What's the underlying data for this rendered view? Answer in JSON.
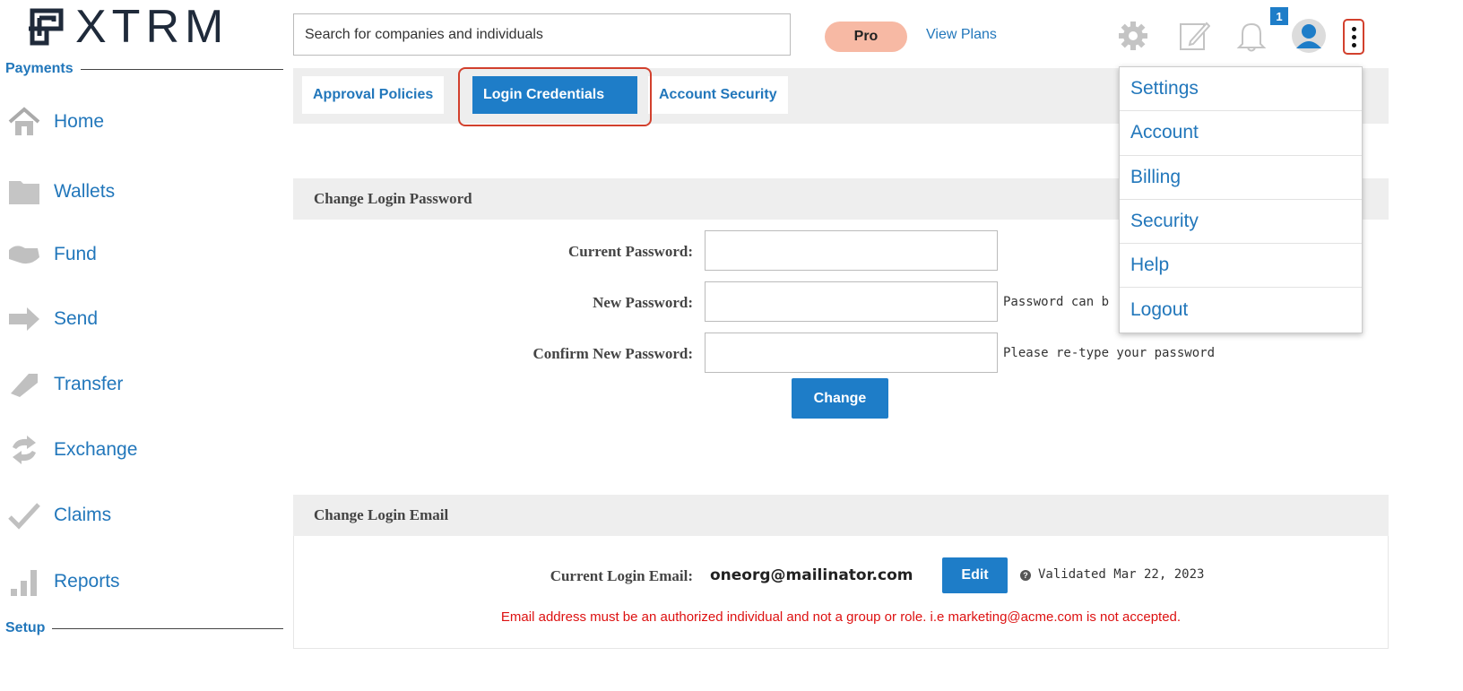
{
  "logo": {
    "text": "XTRM"
  },
  "sidebar": {
    "payments_label": "Payments",
    "setup_label": "Setup",
    "items": [
      {
        "label": "Home",
        "icon": "home-icon"
      },
      {
        "label": "Wallets",
        "icon": "folder-icon"
      },
      {
        "label": "Fund",
        "icon": "fund-icon"
      },
      {
        "label": "Send",
        "icon": "arrow-right-icon"
      },
      {
        "label": "Transfer",
        "icon": "transfer-icon"
      },
      {
        "label": "Exchange",
        "icon": "exchange-icon"
      },
      {
        "label": "Claims",
        "icon": "checkmark-icon"
      },
      {
        "label": "Reports",
        "icon": "bar-chart-icon"
      }
    ]
  },
  "header": {
    "search_placeholder": "Search for companies and individuals",
    "pro_label": "Pro",
    "view_plans_label": "View Plans",
    "notification_count": "1",
    "icons": [
      "gear-icon",
      "edit-icon",
      "bell-icon",
      "user-avatar-icon",
      "more-vertical-icon"
    ]
  },
  "tabs": [
    {
      "label": "Approval Policies",
      "active": false
    },
    {
      "label": "Login Credentials",
      "active": true
    },
    {
      "label": "Account Security",
      "active": false
    }
  ],
  "change_password": {
    "title": "Change Login Password",
    "current_label": "Current Password:",
    "new_label": "New Password:",
    "new_hint": "Password can b",
    "confirm_label": "Confirm New Password:",
    "confirm_hint": "Please re-type your password",
    "button_label": "Change"
  },
  "change_email": {
    "title": "Change Login Email",
    "current_label": "Current Login Email:",
    "email_value": "oneorg@mailinator.com",
    "edit_label": "Edit",
    "validated_text": "Validated Mar 22, 2023",
    "warning": "Email address must be an authorized individual and not a group or role. i.e marketing@acme.com is not accepted."
  },
  "dropdown_menu": {
    "items": [
      "Settings",
      "Account",
      "Billing",
      "Security",
      "Help",
      "Logout"
    ]
  },
  "colors": {
    "accent": "#1e7dc8",
    "link": "#2277bb",
    "highlight": "#d2402d",
    "pro_pill": "#f7b9a4",
    "warning": "#dd1111"
  }
}
